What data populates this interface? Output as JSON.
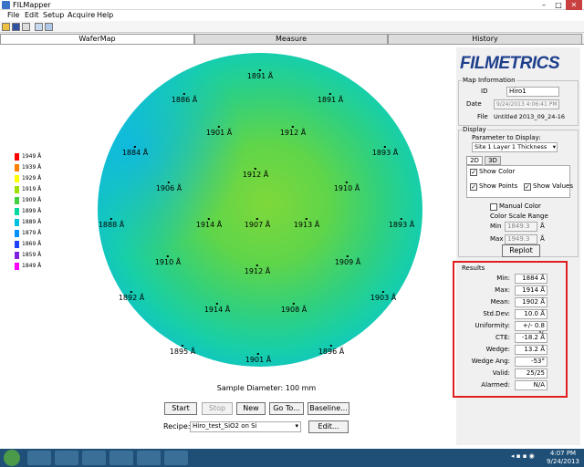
{
  "window": {
    "title": "FILMapper"
  },
  "menu": [
    "File",
    "Edit",
    "Setup",
    "Acquire",
    "Help"
  ],
  "tabs": [
    "WaferMap",
    "Measure",
    "History"
  ],
  "brand": "FILMETRICS",
  "map_info": {
    "heading": "Map Information",
    "id_label": "ID",
    "id_value": "Hiro1",
    "date_label": "Date",
    "date_value": "9/24/2013 4:06:41 PM",
    "file_label": "File",
    "file_value": "Untitled 2013_09_24-16"
  },
  "display": {
    "heading": "Display",
    "param_label": "Parameter to Display:",
    "param_value": "Site 1 Layer 1 Thickness",
    "tab_2d": "2D",
    "tab_3d": "3D",
    "show_color": "Show Color",
    "show_points": "Show Points",
    "show_values": "Show Values",
    "manual_color": "Manual Color",
    "scale_heading": "Color Scale Range",
    "min_label": "Min",
    "min_value": "1849.3",
    "min_unit": "Å",
    "max_label": "Max",
    "max_value": "1949.3",
    "max_unit": "Å",
    "replot": "Replot"
  },
  "results": {
    "heading": "Results",
    "rows": [
      {
        "label": "Min:",
        "value": "1884 Å"
      },
      {
        "label": "Max:",
        "value": "1914 Å"
      },
      {
        "label": "Mean:",
        "value": "1902 Å"
      },
      {
        "label": "Std.Dev:",
        "value": "10.0 Å"
      },
      {
        "label": "Uniformity:",
        "value": "+/- 0.8 %"
      },
      {
        "label": "CTE:",
        "value": "-18.2 Å"
      },
      {
        "label": "Wedge:",
        "value": "13.2 Å"
      },
      {
        "label": "Wedge Ang:",
        "value": "-53°"
      },
      {
        "label": "Valid:",
        "value": "25/25"
      },
      {
        "label": "Alarmed:",
        "value": "N/A"
      }
    ],
    "highlight_color": "#e02020"
  },
  "legend": [
    "1949 Å",
    "1939 Å",
    "1929 Å",
    "1919 Å",
    "1909 Å",
    "1899 Å",
    "1889 Å",
    "1879 Å",
    "1869 Å",
    "1859 Å",
    "1849 Å"
  ],
  "legend_colors": [
    "#ff0000",
    "#ff8000",
    "#ffff00",
    "#a0e000",
    "#40d040",
    "#00d8a0",
    "#00c0e0",
    "#0090ff",
    "#2040ff",
    "#8020e0",
    "#ff00ff"
  ],
  "map_points": [
    "1891 Å",
    "1886 Å",
    "1891 Å",
    "1901 Å",
    "1912 Å",
    "1884 Å",
    "1893 Å",
    "1912 Å",
    "1906 Å",
    "1910 Å",
    "1888 Å",
    "1914 Å",
    "1907 Å",
    "1913 Å",
    "1893 Å",
    "1910 Å",
    "1909 Å",
    "1912 Å",
    "1892 Å",
    "1903 Å",
    "1914 Å",
    "1908 Å",
    "1895 Å",
    "1896 Å",
    "1901 Å"
  ],
  "sample_diameter": "Sample Diameter: 100 mm",
  "controls": {
    "start": "Start",
    "stop": "Stop",
    "new": "New",
    "goto": "Go To...",
    "baseline": "Baseline...",
    "recipe_label": "Recipe:",
    "recipe_value": "Hiro_test_SiO2 on Si",
    "edit": "Edit..."
  },
  "taskbar": {
    "time": "4:07 PM",
    "date": "9/24/2013"
  }
}
